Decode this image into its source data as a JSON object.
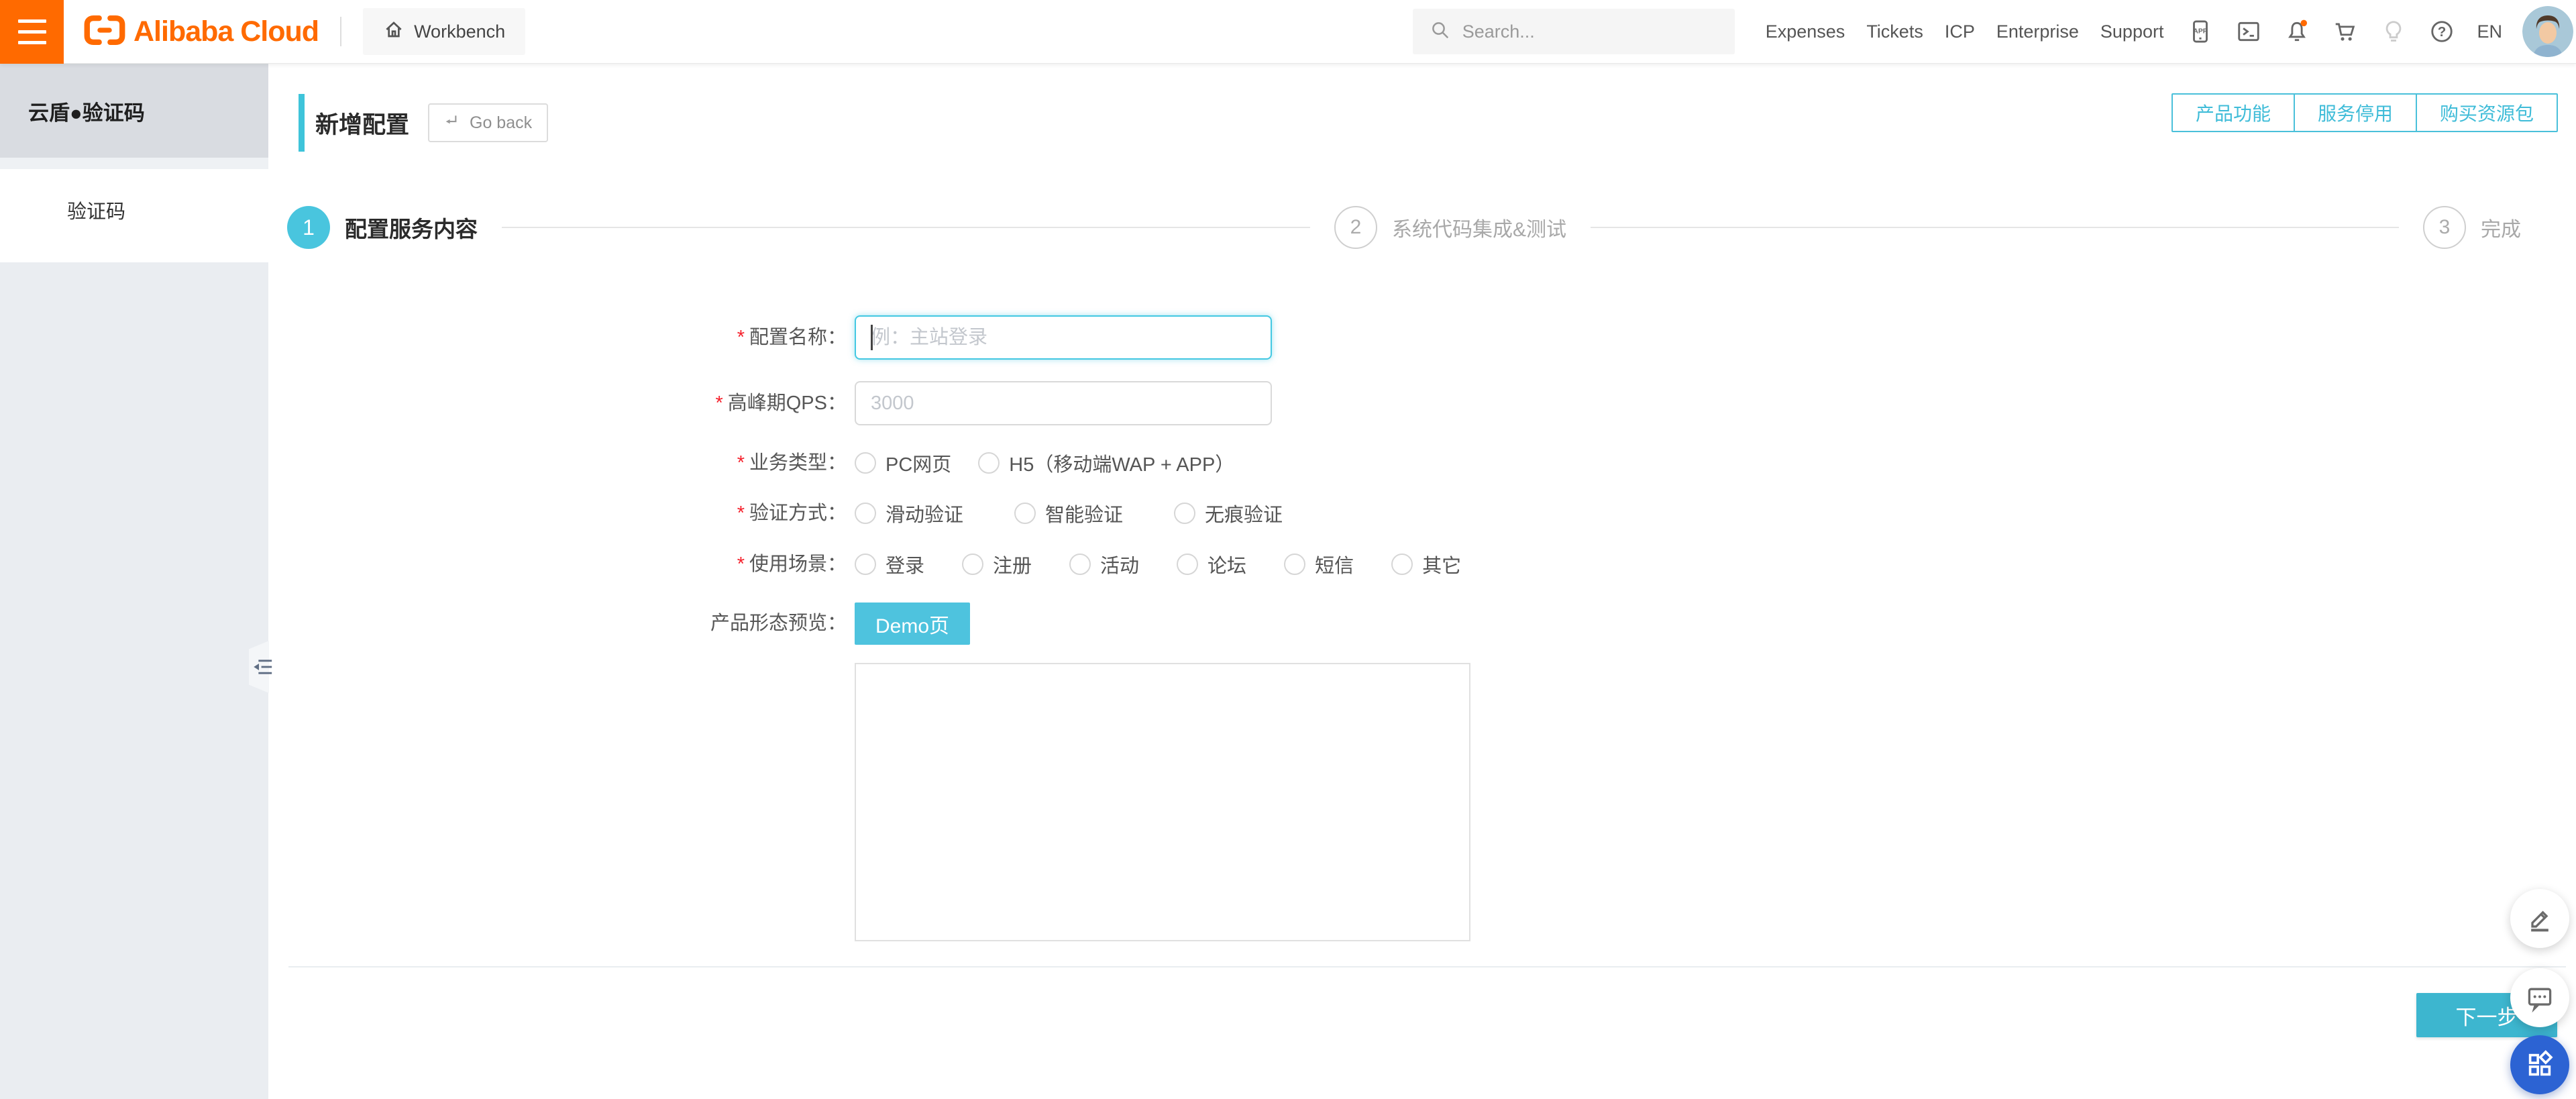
{
  "header": {
    "brand": "Alibaba Cloud",
    "workbench_label": "Workbench",
    "search_placeholder": "Search...",
    "nav_items": [
      "Expenses",
      "Tickets",
      "ICP",
      "Enterprise",
      "Support"
    ],
    "language": "EN"
  },
  "sidebar": {
    "product_title": "云盾●验证码",
    "menu_items": [
      {
        "label": "验证码",
        "selected": true
      }
    ]
  },
  "page_header": {
    "title": "新增配置",
    "go_back_label": "Go back",
    "action_buttons": [
      "产品功能",
      "服务停用",
      "购买资源包"
    ]
  },
  "steps": [
    {
      "num": "1",
      "label": "配置服务内容",
      "state": "active"
    },
    {
      "num": "2",
      "label": "系统代码集成&测试",
      "state": "upcoming"
    },
    {
      "num": "3",
      "label": "完成",
      "state": "upcoming"
    }
  ],
  "form": {
    "config_name": {
      "label": "配置名称：",
      "required": true,
      "value": "",
      "placeholder": "例：主站登录"
    },
    "peak_qps": {
      "label": "高峰期QPS：",
      "required": true,
      "value": "",
      "placeholder": "3000"
    },
    "business_type": {
      "label": "业务类型：",
      "required": true,
      "selected": "",
      "options": [
        "PC网页",
        "H5（移动端WAP + APP）"
      ]
    },
    "verify_mode": {
      "label": "验证方式：",
      "required": true,
      "selected": "",
      "options": [
        "滑动验证",
        "智能验证",
        "无痕验证"
      ]
    },
    "use_scene": {
      "label": "使用场景：",
      "required": true,
      "selected": "",
      "options": [
        "登录",
        "注册",
        "活动",
        "论坛",
        "短信",
        "其它"
      ]
    },
    "preview": {
      "label": "产品形态预览：",
      "demo_button": "Demo页"
    }
  },
  "footer": {
    "next_button": "下一步"
  },
  "colors": {
    "brand_orange": "#ff6a00",
    "accent_cyan": "#4ac2dc",
    "next_button_cyan": "#3db6cf",
    "fab_blue": "#2c63d3",
    "required_red": "#f5222d"
  }
}
